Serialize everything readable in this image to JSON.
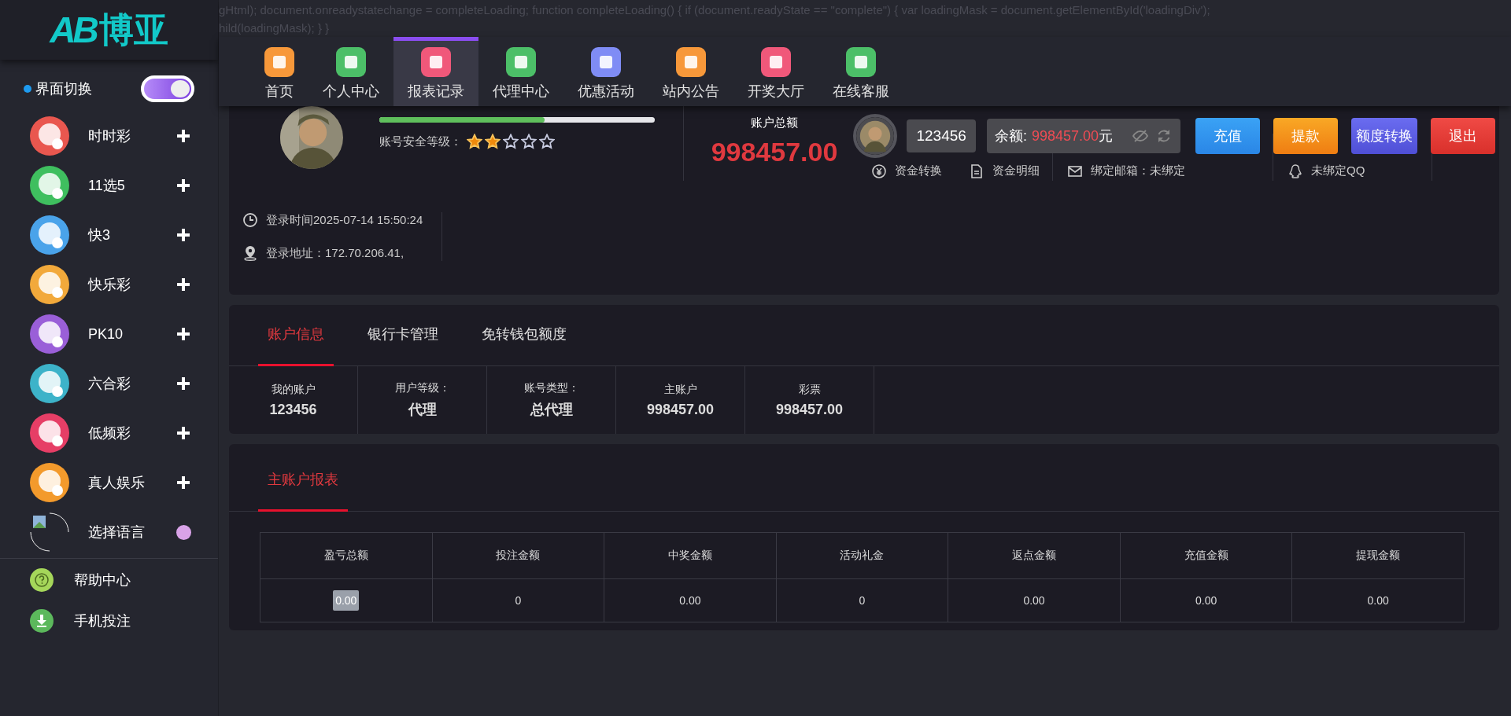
{
  "code_lines": [
    "gHtml); document.onreadystatechange = completeLoading; function completeLoading() { if (document.readyState == \"complete\") { var loadingMask = document.getElementById('loadingDiv');",
    "hild(loadingMask); } }"
  ],
  "logo": {
    "mark": "AB",
    "text": "博亚"
  },
  "theme_toggle": {
    "label": "界面切换",
    "on": true
  },
  "sidebar": {
    "items": [
      {
        "label": "时时彩",
        "kind": "expand",
        "color": "#e9574f"
      },
      {
        "label": "11选5",
        "kind": "expand",
        "color": "#3fbf5f"
      },
      {
        "label": "快3",
        "kind": "expand",
        "color": "#4aa3ea"
      },
      {
        "label": "快乐彩",
        "kind": "expand",
        "color": "#f2a93b"
      },
      {
        "label": "PK10",
        "kind": "expand",
        "color": "#9a5fd8"
      },
      {
        "label": "六合彩",
        "kind": "expand",
        "color": "#3db3c9"
      },
      {
        "label": "低频彩",
        "kind": "expand",
        "color": "#e63e66"
      },
      {
        "label": "真人娱乐",
        "kind": "expand",
        "color": "#f39a2c"
      },
      {
        "label": "选择语言",
        "kind": "dot",
        "color": "#d9a3e8"
      }
    ],
    "footer": [
      {
        "label": "帮助中心",
        "kind": "help"
      },
      {
        "label": "手机投注",
        "kind": "download"
      }
    ]
  },
  "nav": [
    {
      "label": "首页",
      "selected": false,
      "color": "#f7983a"
    },
    {
      "label": "个人中心",
      "selected": false,
      "color": "#4cbf68"
    },
    {
      "label": "报表记录",
      "selected": true,
      "color": "#f0587a"
    },
    {
      "label": "代理中心",
      "selected": false,
      "color": "#4cbf68"
    },
    {
      "label": "优惠活动",
      "selected": false,
      "color": "#7f8cf5"
    },
    {
      "label": "站内公告",
      "selected": false,
      "color": "#f7983a"
    },
    {
      "label": "开奖大厅",
      "selected": false,
      "color": "#f0587a"
    },
    {
      "label": "在线客服",
      "selected": false,
      "color": "#4cbf68"
    }
  ],
  "profile": {
    "security": {
      "level": 0.6,
      "label": "账号安全等级：",
      "stars": 2
    },
    "total": {
      "label": "账户总额",
      "amount": "998457.00"
    },
    "links": [
      {
        "label": "资金转换",
        "kind": "transfer"
      },
      {
        "label": "资金明细",
        "kind": "detail"
      },
      {
        "label": "绑定邮箱：未绑定",
        "kind": "mail"
      },
      {
        "label": "未绑定QQ",
        "kind": "qq"
      }
    ],
    "login": [
      {
        "label": "登录时间2025-07-14 15:50:24",
        "kind": "clock"
      },
      {
        "label": "登录地址：172.70.206.41,",
        "kind": "pin"
      }
    ]
  },
  "user_bar": {
    "account": "123456",
    "balance_label": "余额:",
    "balance": "998457.00",
    "unit": "元",
    "buttons": [
      {
        "label": "充值",
        "kind": "blue"
      },
      {
        "label": "提款",
        "kind": "orange"
      },
      {
        "label": "额度转换",
        "kind": "purple"
      },
      {
        "label": "退出",
        "kind": "red"
      }
    ]
  },
  "account_tabs": [
    {
      "label": "账户信息",
      "selected": true
    },
    {
      "label": "银行卡管理",
      "selected": false
    },
    {
      "label": "免转钱包额度",
      "selected": false
    }
  ],
  "account_info": [
    {
      "label": "我的账户",
      "value": "123456"
    },
    {
      "label": "用户等级：",
      "value": "代理"
    },
    {
      "label": "账号类型：",
      "value": "总代理"
    },
    {
      "label": "主账户",
      "value": "998457.00"
    },
    {
      "label": "彩票",
      "value": "998457.00"
    }
  ],
  "report_tabs": [
    {
      "label": "主账户报表",
      "selected": true
    }
  ],
  "report_table": {
    "columns": [
      "盈亏总额",
      "投注金额",
      "中奖金额",
      "活动礼金",
      "返点金额",
      "充值金额",
      "提现金额"
    ],
    "rows": [
      [
        "0.00",
        "0",
        "0.00",
        "0",
        "0.00",
        "0.00",
        "0.00"
      ]
    ]
  }
}
